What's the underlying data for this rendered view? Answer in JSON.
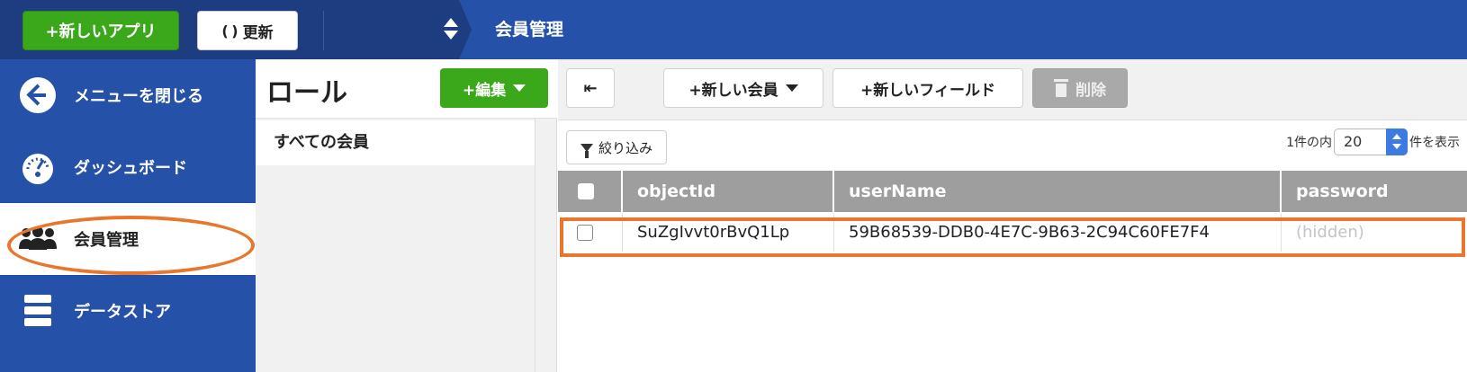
{
  "topbar": {
    "new_app_label": "+新しいアプリ",
    "refresh_icon": "( )",
    "refresh_label": "更新",
    "app_switcher_icon": "up-down-chevron-icon",
    "app_title": "会員管理"
  },
  "sidebar": {
    "items": [
      {
        "label": "メニューを閉じる",
        "icon": "back-arrow-circle-icon"
      },
      {
        "label": "ダッシュボード",
        "icon": "gauge-icon"
      },
      {
        "label": "会員管理",
        "icon": "users-icon",
        "active": true
      },
      {
        "label": "データストア",
        "icon": "database-icon"
      }
    ]
  },
  "roles": {
    "title": "ロール",
    "edit_label": "+編集",
    "items": [
      {
        "label": "すべての会員"
      }
    ]
  },
  "toolbar": {
    "collapse_icon": "⇤",
    "new_member_label": "+新しい会員",
    "new_field_label": "+新しいフィールド",
    "delete_label": "削除"
  },
  "filter": {
    "label": "絞り込み"
  },
  "pager": {
    "prefix": "1件の内",
    "value": "20",
    "suffix": "件を表示"
  },
  "table": {
    "columns": [
      "objectId",
      "userName",
      "password"
    ],
    "rows": [
      {
        "objectId": "SuZgIvvt0rBvQ1Lp",
        "userName": "59B68539-DDB0-4E7C-9B63-2C94C60FE7F4",
        "password": "(hidden)"
      }
    ]
  },
  "colors": {
    "brand_blue": "#2651a9",
    "dark_blue": "#1d3d80",
    "green": "#3aa81a",
    "highlight_orange": "#e8762d",
    "header_gray": "#9e9e9e"
  }
}
